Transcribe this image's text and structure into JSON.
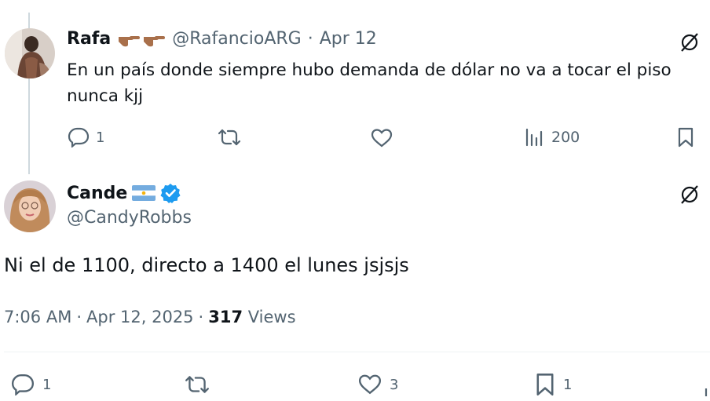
{
  "reply": {
    "name": "Rafa",
    "name_emoji": "👉🏽👉🏽",
    "handle": "@RafancioARG",
    "separator": "·",
    "date": "Apr 12",
    "text": "En un país donde siempre hubo demanda de dólar no va a tocar el piso nunca kjj",
    "actions": {
      "replies": "1",
      "reposts": "",
      "likes": "",
      "views": "200"
    },
    "icons": [
      "grok-icon",
      "reply-icon",
      "repost-icon",
      "like-icon",
      "views-icon",
      "bookmark-icon"
    ]
  },
  "main": {
    "name": "Cande",
    "flag": "argentina-flag",
    "verified": true,
    "handle": "@CandyRobbs",
    "text": "Ni el de 1100, directo a 1400 el lunes jsjsjs",
    "time": "7:06 AM",
    "separator": "·",
    "date": "Apr 12, 2025",
    "separator2": "·",
    "views_count": "317",
    "views_label": "Views",
    "actions": {
      "replies": "1",
      "reposts": "",
      "likes": "3",
      "bookmarks": "1"
    }
  },
  "colors": {
    "text": "#0f1419",
    "secondary": "#536471",
    "verified": "#1d9bf0",
    "line": "#cfd9de"
  }
}
